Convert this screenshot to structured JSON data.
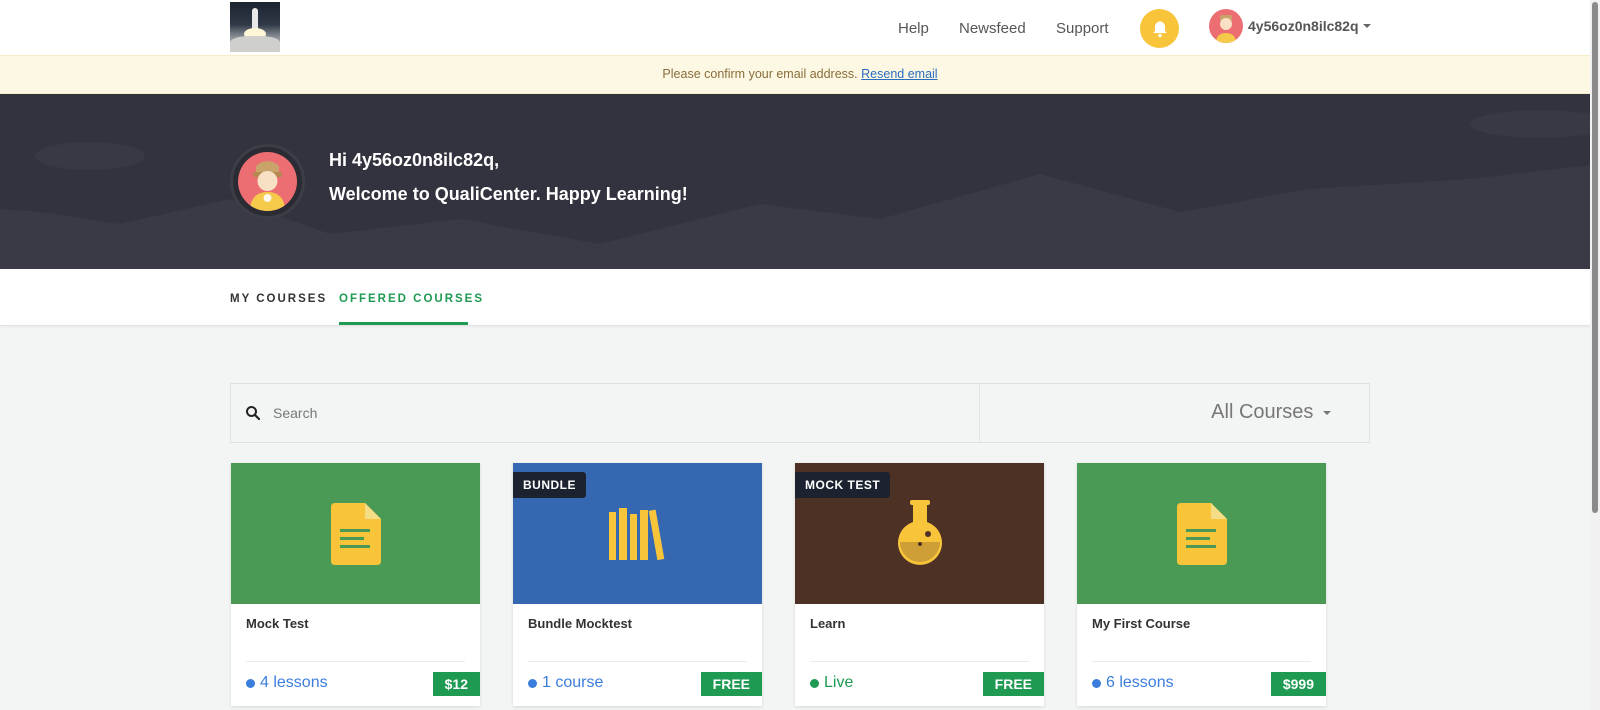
{
  "nav": {
    "links": [
      "Help",
      "Newsfeed",
      "Support"
    ],
    "username": "4y56oz0n8ilc82q"
  },
  "alert": {
    "message": "Please confirm your email address.",
    "link_label": "Resend email"
  },
  "hero": {
    "greeting": "Hi 4y56oz0n8ilc82q,",
    "welcome": "Welcome to QualiCenter. Happy Learning!"
  },
  "tabs": [
    {
      "label": "MY COURSES",
      "active": false
    },
    {
      "label": "OFFERED COURSES",
      "active": true
    }
  ],
  "search": {
    "placeholder": "Search",
    "filter_label": "All Courses"
  },
  "courses": [
    {
      "title": "Mock Test",
      "tag": "",
      "meta": "4 lessons",
      "price": "$12",
      "icon": "document-icon",
      "color": "#4a9a55"
    },
    {
      "title": "Bundle Mocktest",
      "tag": "BUNDLE",
      "meta": "1 course",
      "price": "FREE",
      "icon": "books-icon",
      "color": "#3568b0"
    },
    {
      "title": "Learn",
      "tag": "MOCK TEST",
      "meta": "Live",
      "price": "FREE",
      "icon": "flask-icon",
      "color": "#4d3125"
    },
    {
      "title": "My First Course",
      "tag": "",
      "meta": "6 lessons",
      "price": "$999",
      "icon": "document-icon",
      "color": "#4a9a55"
    }
  ],
  "colors": {
    "accent": "#1f9a53",
    "link": "#3b7ddd",
    "hero_bg": "#33333f",
    "icon_yellow": "#f8c43a"
  }
}
